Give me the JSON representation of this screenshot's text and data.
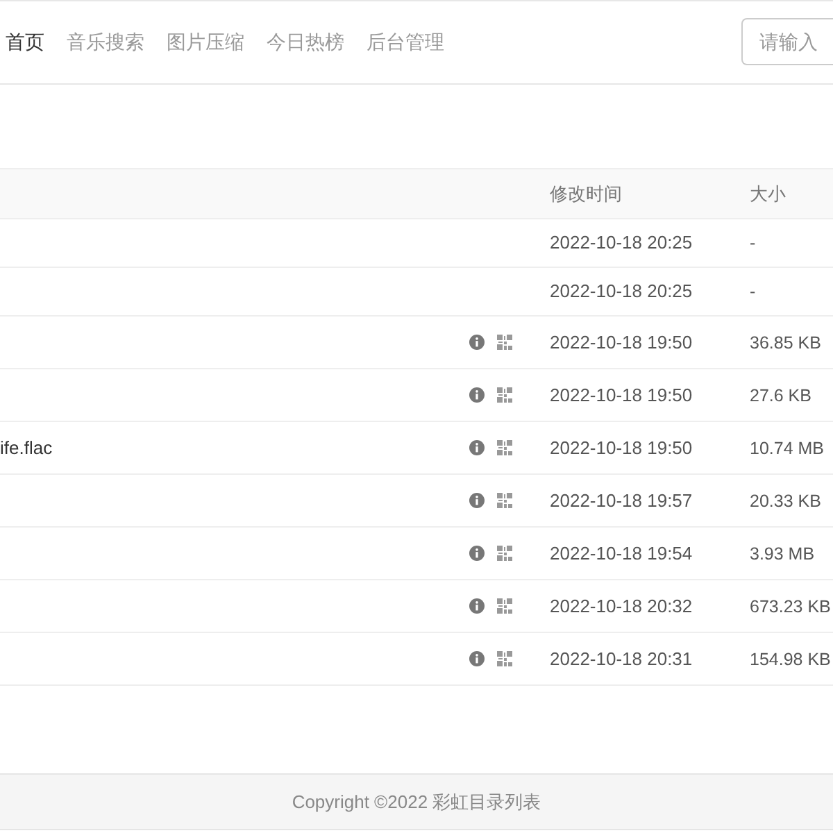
{
  "navbar": {
    "items": [
      {
        "label": "首页",
        "selected": true
      },
      {
        "label": "音乐搜索",
        "selected": false
      },
      {
        "label": "图片压缩",
        "selected": false
      },
      {
        "label": "今日热榜",
        "selected": false
      },
      {
        "label": "后台管理",
        "selected": false
      }
    ],
    "search": {
      "placeholder": "请输入"
    }
  },
  "table": {
    "columns": [
      "修改时间",
      "大小"
    ],
    "rows": [
      {
        "kind": "folder",
        "modified": "2022-10-18 20:25",
        "size": "-"
      },
      {
        "kind": "folder",
        "modified": "2022-10-18 20:25",
        "size": "-"
      },
      {
        "kind": "file",
        "modified": "2022-10-18 19:50",
        "size": "36.85 KB"
      },
      {
        "kind": "file",
        "modified": "2022-10-18 19:50",
        "size": "27.6 KB"
      },
      {
        "kind": "file",
        "name": "ife.flac",
        "modified": "2022-10-18 19:50",
        "size": "10.74 MB"
      },
      {
        "kind": "file",
        "modified": "2022-10-18 19:57",
        "size": "20.33 KB"
      },
      {
        "kind": "file",
        "modified": "2022-10-18 19:54",
        "size": "3.93 MB"
      },
      {
        "kind": "file",
        "modified": "2022-10-18 20:32",
        "size": "673.23 KB"
      },
      {
        "kind": "file",
        "modified": "2022-10-18 20:31",
        "size": "154.98 KB"
      }
    ]
  },
  "footer": {
    "text": "Copyright ©2022 彩虹目录列表"
  }
}
